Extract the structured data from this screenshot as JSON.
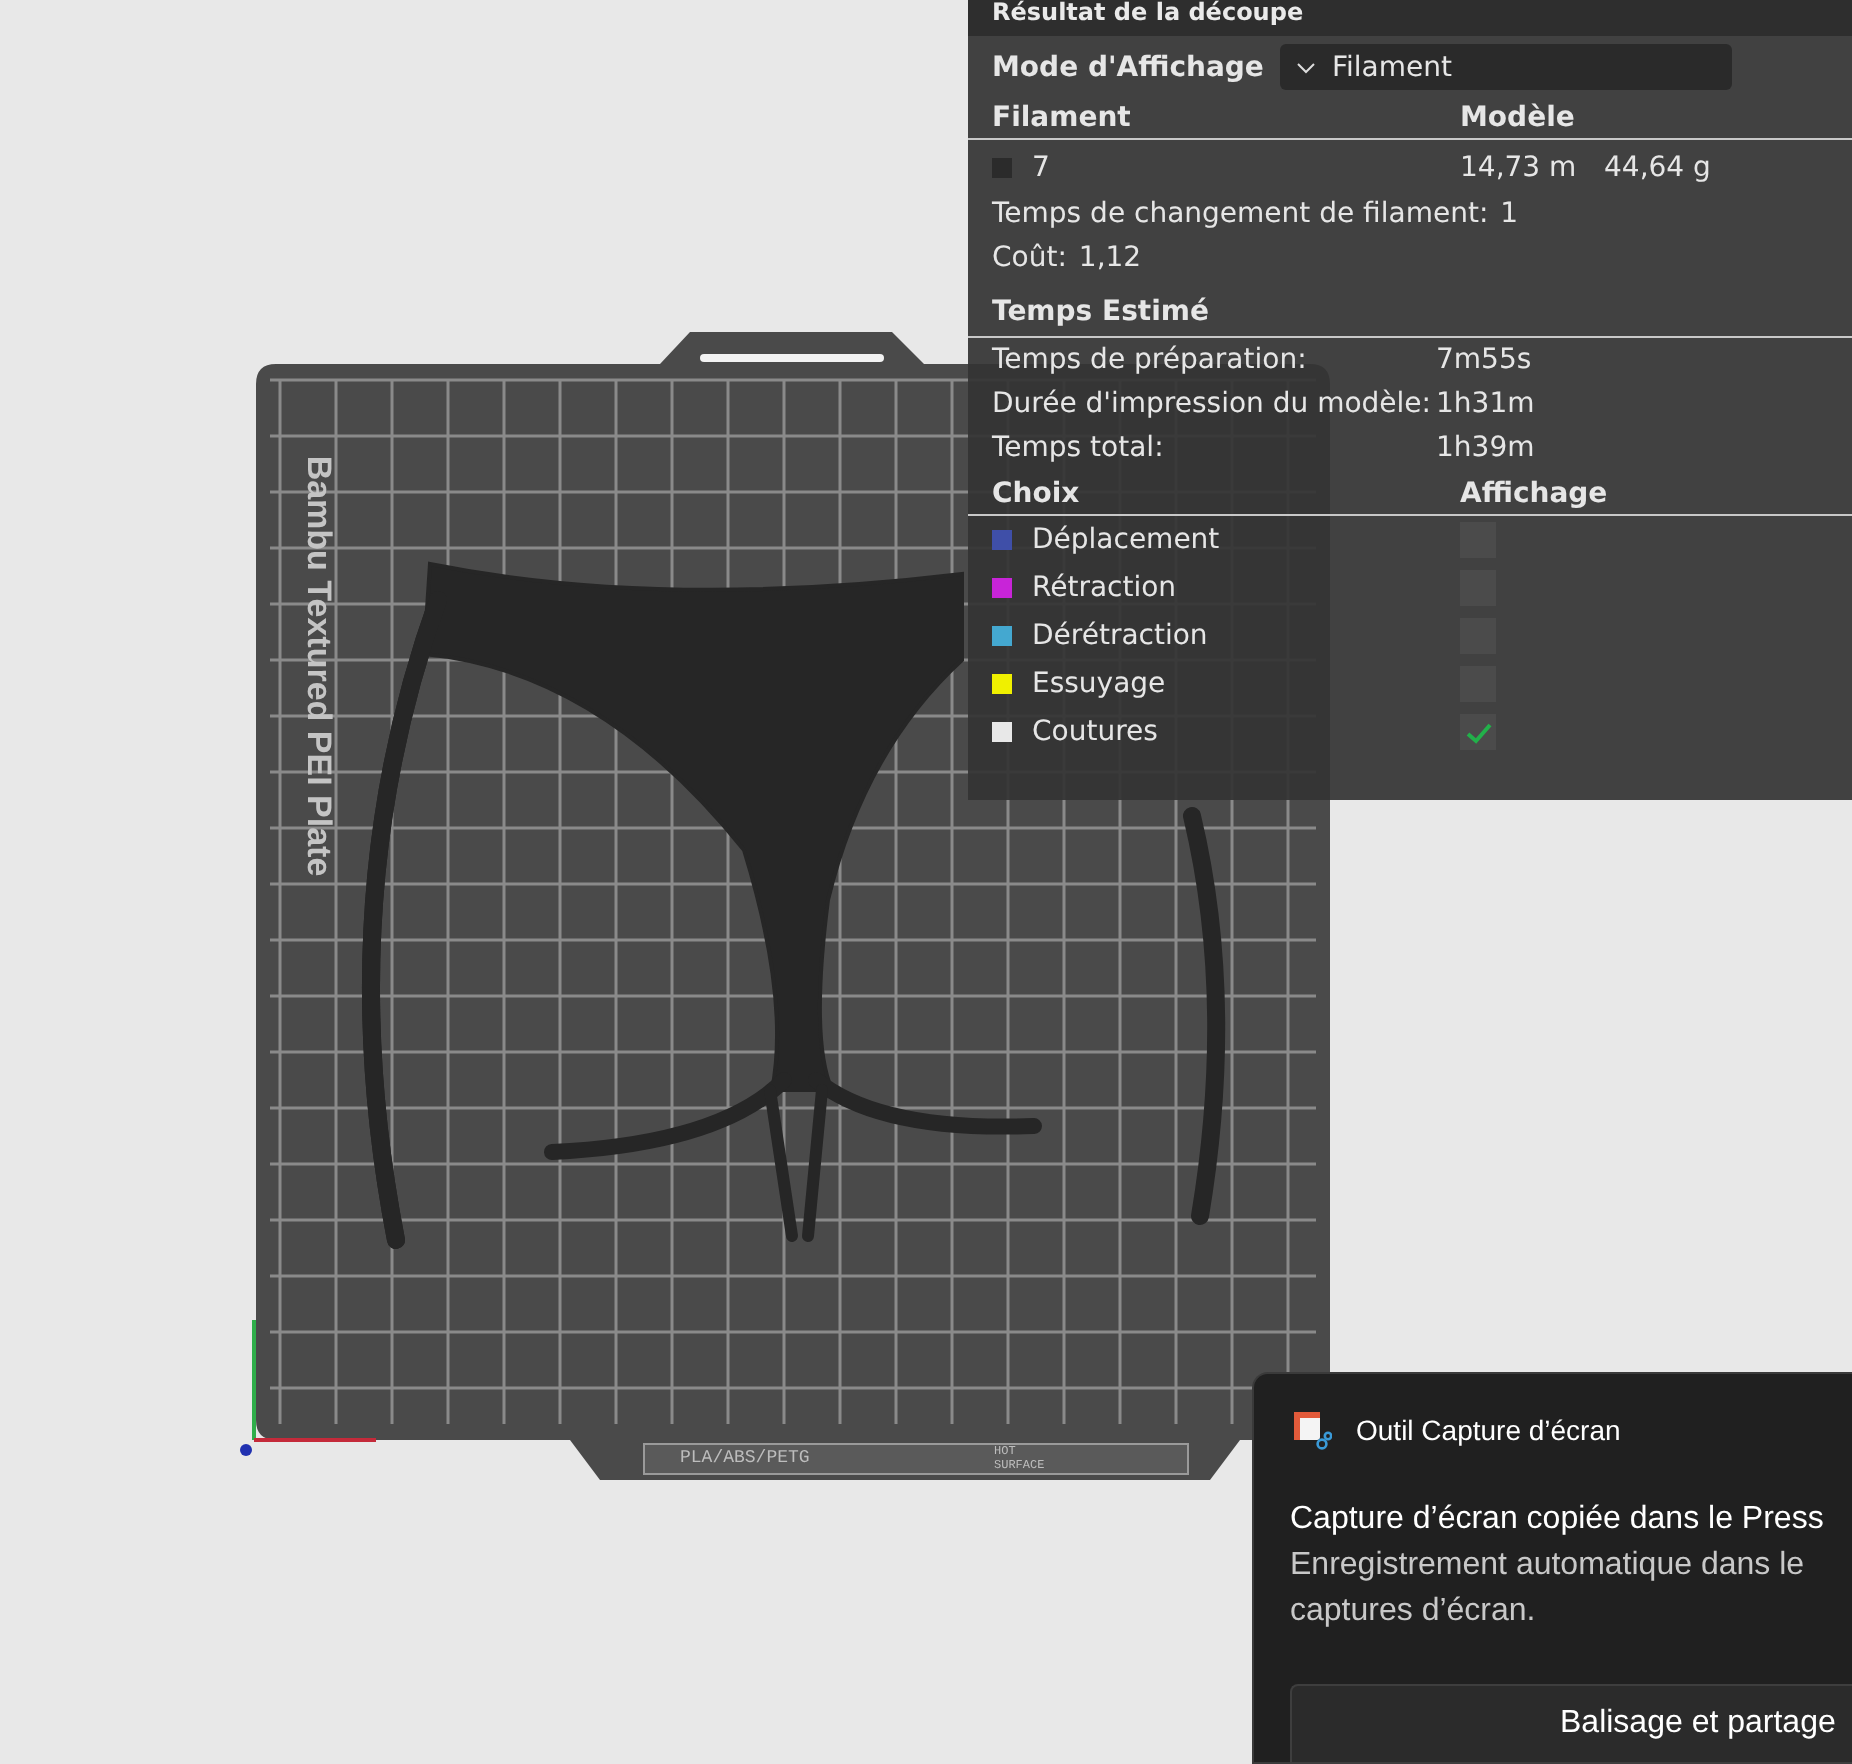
{
  "panel": {
    "title": "Résultat de la découpe",
    "display_mode": {
      "label": "Mode d'Affichage",
      "value": "Filament"
    },
    "filament_table": {
      "columns": [
        "Filament",
        "Modèle"
      ],
      "rows": [
        {
          "color": "#2b2b2b",
          "name": "7",
          "length": "14,73 m",
          "weight": "44,64 g"
        }
      ]
    },
    "stats": [
      {
        "label": "Temps de changement de filament:",
        "value": "1"
      },
      {
        "label": "Coût:",
        "value": "1,12"
      }
    ],
    "time": {
      "heading": "Temps Estimé",
      "rows": [
        {
          "label": "Temps de préparation:",
          "value": "7m55s"
        },
        {
          "label": "Durée d'impression du modèle:",
          "value": "1h31m"
        },
        {
          "label": "Temps total:",
          "value": "1h39m"
        }
      ]
    },
    "options": {
      "columns": [
        "Choix",
        "Affichage"
      ],
      "items": [
        {
          "label": "Déplacement",
          "color": "#3f4fa8",
          "checked": false
        },
        {
          "label": "Rétraction",
          "color": "#c824d8",
          "checked": false
        },
        {
          "label": "Dérétraction",
          "color": "#44a8d0",
          "checked": false
        },
        {
          "label": "Essuyage",
          "color": "#f0f000",
          "checked": false
        },
        {
          "label": "Coutures",
          "color": "#e8e8e8",
          "checked": true
        }
      ]
    }
  },
  "plate": {
    "name": "Bambu Textured PEI Plate",
    "material_label": "PLA/ABS/PETG",
    "warning": "HOT SURFACE"
  },
  "notification": {
    "app": "Outil Capture d’écran",
    "title": "Capture d’écran copiée dans le Press",
    "body_lines": [
      "Enregistrement automatique dans le",
      "captures d’écran."
    ],
    "button": "Balisage et partage"
  }
}
